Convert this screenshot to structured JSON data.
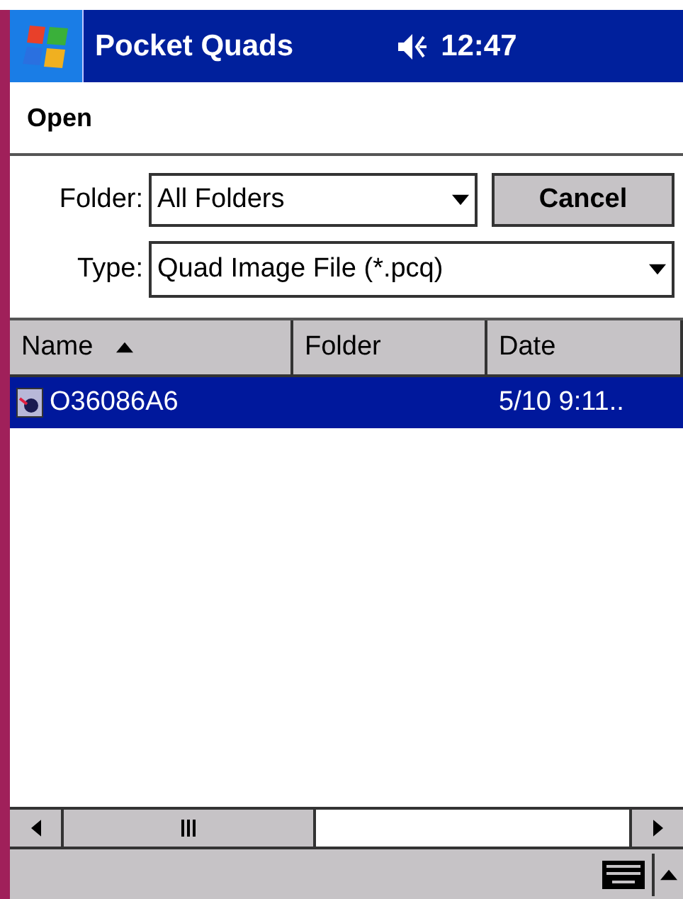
{
  "title_bar": {
    "app_name": "Pocket Quads",
    "time": "12:47"
  },
  "dialog_title": "Open",
  "folder": {
    "label": "Folder:",
    "value": "All Folders"
  },
  "cancel_button": "Cancel",
  "type": {
    "label": "Type:",
    "value": "Quad Image File (*.pcq)"
  },
  "table": {
    "columns": [
      {
        "label": "Name",
        "sorted": true
      },
      {
        "label": "Folder",
        "sorted": false
      },
      {
        "label": "Date",
        "sorted": false
      }
    ],
    "rows": [
      {
        "name": "O36086A6",
        "date": "5/10 9:11..",
        "selected": true
      }
    ]
  }
}
